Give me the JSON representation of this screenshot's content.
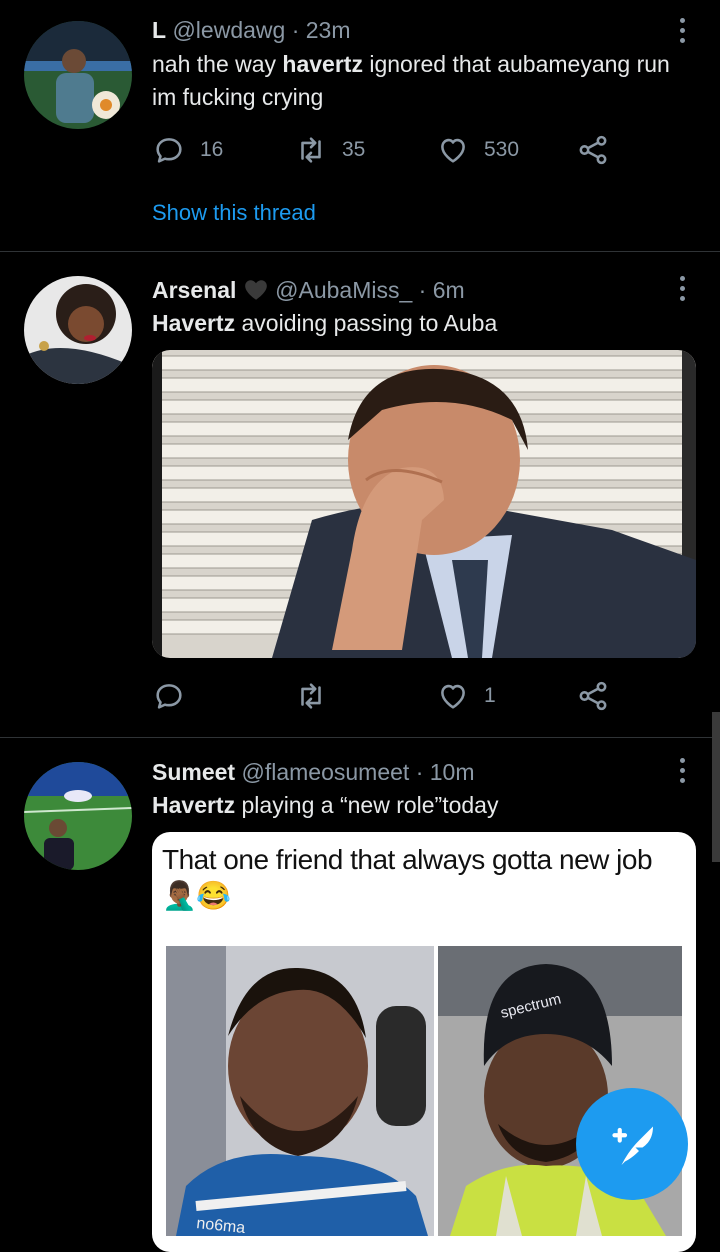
{
  "tweets": [
    {
      "name": "L",
      "handle": "@lewdawg",
      "time": "· 23m",
      "text_pre": "nah the way ",
      "text_bold": "havertz",
      "text_post": " ignored that aubameyang run im fucking crying",
      "replies": "16",
      "retweets": "35",
      "likes": "530",
      "show_thread": "Show this thread"
    },
    {
      "name": "Arsenal",
      "handle": "@AubaMiss_",
      "time": "· 6m",
      "text_bold": "Havertz",
      "text_post": "  avoiding passing  to Auba",
      "replies": "",
      "retweets": "",
      "likes": "1"
    },
    {
      "name": "Sumeet",
      "handle": "@flameosumeet",
      "time": "· 10m",
      "text_bold": "Havertz",
      "text_post": " playing a “new role”today",
      "meme_caption": "That one friend that always gotta new job🤦🏾‍♂️😂",
      "beanie_text": "spectrum",
      "jacket_text": "no6ma"
    }
  ],
  "colors": {
    "accent": "#1d9bf0",
    "muted": "#8b98a5",
    "divider": "#2f3336"
  },
  "icons": [
    "reply-icon",
    "retweet-icon",
    "like-icon",
    "share-icon",
    "more-icon",
    "compose-icon"
  ]
}
